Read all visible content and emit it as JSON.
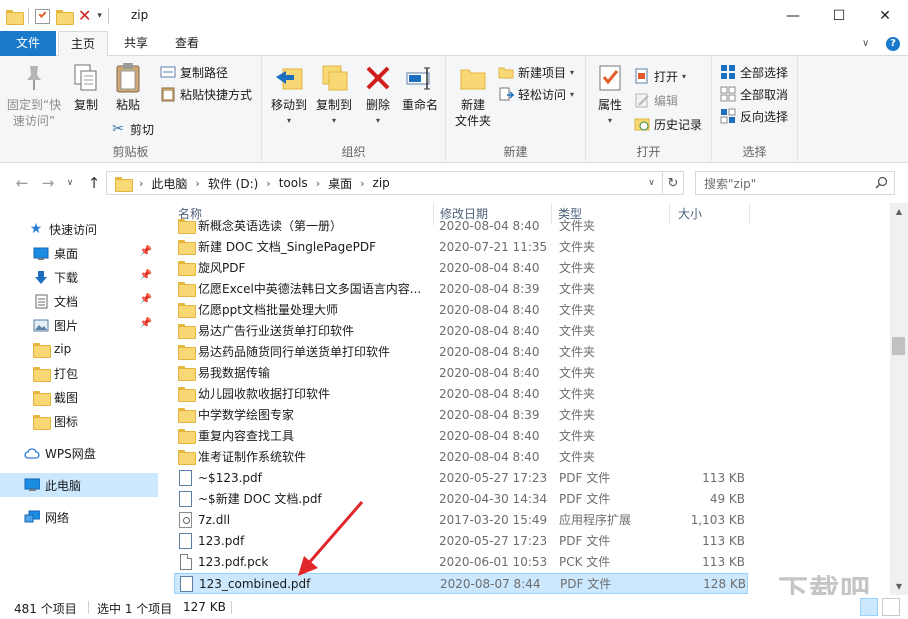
{
  "window": {
    "title": "zip",
    "minimize": "—",
    "maximize": "☐",
    "close": "✕"
  },
  "ribbon_tabs": [
    {
      "label": "文件"
    },
    {
      "label": "主页"
    },
    {
      "label": "共享"
    },
    {
      "label": "查看"
    }
  ],
  "ribbon": {
    "clipboard": {
      "label": "剪贴板",
      "pin_quick_access": "固定到“快\n速访问”",
      "copy": "复制",
      "paste": "粘贴",
      "copy_path": "复制路径",
      "paste_shortcut": "粘贴快捷方式",
      "cut": "剪切"
    },
    "organize": {
      "label": "组织",
      "move_to": "移动到",
      "copy_to": "复制到",
      "delete": "删除",
      "rename": "重命名"
    },
    "new": {
      "label": "新建",
      "new_folder": "新建\n文件夹",
      "new_item": "新建项目",
      "easy_access": "轻松访问"
    },
    "open": {
      "label": "打开",
      "properties": "属性",
      "open": "打开",
      "edit": "编辑",
      "history": "历史记录"
    },
    "select": {
      "label": "选择",
      "select_all": "全部选择",
      "select_none": "全部取消",
      "invert": "反向选择"
    }
  },
  "address": {
    "crumbs": [
      "此电脑",
      "软件 (D:)",
      "tools",
      "桌面",
      "zip"
    ],
    "search_placeholder": "搜索\"zip\""
  },
  "nav_pane": {
    "quick_access": "快速访问",
    "items": [
      {
        "label": "桌面",
        "icon": "desktop-icon",
        "pinned": true
      },
      {
        "label": "下载",
        "icon": "download-icon",
        "pinned": true
      },
      {
        "label": "文档",
        "icon": "document-icon",
        "pinned": true
      },
      {
        "label": "图片",
        "icon": "picture-icon",
        "pinned": true
      },
      {
        "label": "zip",
        "icon": "folder-icon",
        "pinned": false
      },
      {
        "label": "打包",
        "icon": "folder-icon",
        "pinned": false
      },
      {
        "label": "截图",
        "icon": "folder-icon",
        "pinned": false
      },
      {
        "label": "图标",
        "icon": "folder-icon",
        "pinned": false
      }
    ],
    "wps": "WPS网盘",
    "this_pc": "此电脑",
    "network": "网络"
  },
  "columns": {
    "name": "名称",
    "date": "修改日期",
    "type": "类型",
    "size": "大小"
  },
  "files": [
    {
      "name": "新概念英语选读（第一册）",
      "date": "2020-08-04 8:40",
      "type": "文件夹",
      "size": "",
      "icon": "folder"
    },
    {
      "name": "新建 DOC 文档_SinglePagePDF",
      "date": "2020-07-21 11:35",
      "type": "文件夹",
      "size": "",
      "icon": "folder"
    },
    {
      "name": "旋风PDF",
      "date": "2020-08-04 8:40",
      "type": "文件夹",
      "size": "",
      "icon": "folder"
    },
    {
      "name": "亿愿Excel中英德法韩日文多国语言内容...",
      "date": "2020-08-04 8:39",
      "type": "文件夹",
      "size": "",
      "icon": "folder"
    },
    {
      "name": "亿愿ppt文档批量处理大师",
      "date": "2020-08-04 8:40",
      "type": "文件夹",
      "size": "",
      "icon": "folder"
    },
    {
      "name": "易达广告行业送货单打印软件",
      "date": "2020-08-04 8:40",
      "type": "文件夹",
      "size": "",
      "icon": "folder"
    },
    {
      "name": "易达药品随货同行单送货单打印软件",
      "date": "2020-08-04 8:40",
      "type": "文件夹",
      "size": "",
      "icon": "folder"
    },
    {
      "name": "易我数据传输",
      "date": "2020-08-04 8:40",
      "type": "文件夹",
      "size": "",
      "icon": "folder"
    },
    {
      "name": "幼儿园收款收据打印软件",
      "date": "2020-08-04 8:40",
      "type": "文件夹",
      "size": "",
      "icon": "folder"
    },
    {
      "name": "中学数学绘图专家",
      "date": "2020-08-04 8:39",
      "type": "文件夹",
      "size": "",
      "icon": "folder"
    },
    {
      "name": "重复内容查找工具",
      "date": "2020-08-04 8:40",
      "type": "文件夹",
      "size": "",
      "icon": "folder"
    },
    {
      "name": "准考证制作系统软件",
      "date": "2020-08-04 8:40",
      "type": "文件夹",
      "size": "",
      "icon": "folder"
    },
    {
      "name": "~$123.pdf",
      "date": "2020-05-27 17:23",
      "type": "PDF 文件",
      "size": "113 KB",
      "icon": "pdf"
    },
    {
      "name": "~$新建 DOC 文档.pdf",
      "date": "2020-04-30 14:34",
      "type": "PDF 文件",
      "size": "49 KB",
      "icon": "pdf"
    },
    {
      "name": "7z.dll",
      "date": "2017-03-20 15:49",
      "type": "应用程序扩展",
      "size": "1,103 KB",
      "icon": "dll"
    },
    {
      "name": "123.pdf",
      "date": "2020-05-27 17:23",
      "type": "PDF 文件",
      "size": "113 KB",
      "icon": "pdf"
    },
    {
      "name": "123.pdf.pck",
      "date": "2020-06-01 10:53",
      "type": "PCK 文件",
      "size": "113 KB",
      "icon": "doc"
    },
    {
      "name": "123_combined.pdf",
      "date": "2020-08-07 8:44",
      "type": "PDF 文件",
      "size": "128 KB",
      "icon": "pdf",
      "selected": true
    }
  ],
  "status": {
    "count": "481 个项目",
    "selected": "选中 1 个项目",
    "size": "127 KB"
  },
  "watermark": "下载吧",
  "colors": {
    "file_tab": "#1979ca",
    "selection": "#cce8ff",
    "selection_border": "#99d1ff",
    "arrow": "#e0282a"
  }
}
